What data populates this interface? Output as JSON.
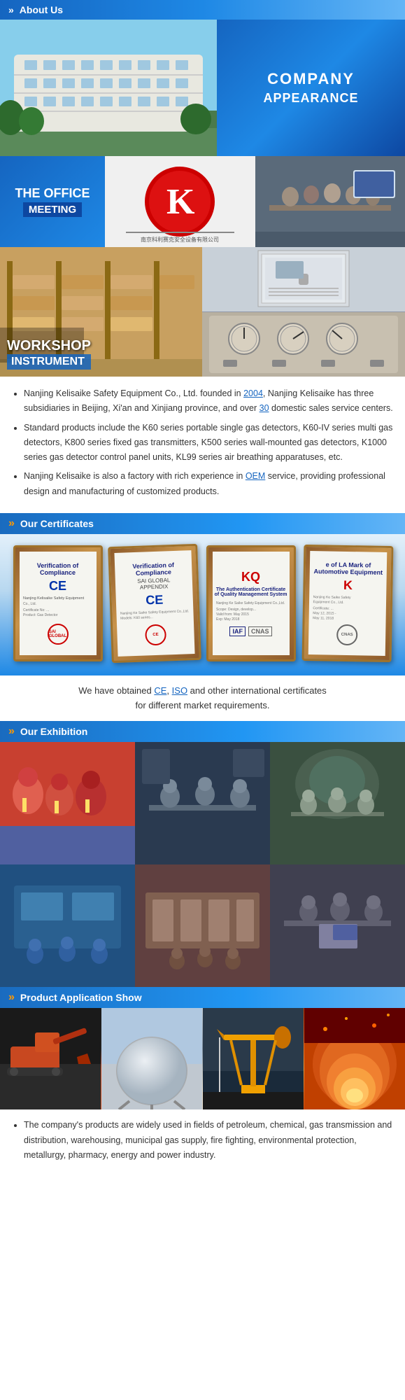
{
  "header": {
    "title": "About Us",
    "chevron": "»"
  },
  "sections": {
    "company": {
      "label_main": "COMPANY",
      "label_sub": "APPEARANCE",
      "office_main": "THE OFFICE",
      "office_sub": "MEETING",
      "workshop_main": "WORKSHOP",
      "workshop_sub": "INSTRUMENT"
    },
    "description": {
      "bullets": [
        "Nanjing Kelisaike Safety Equipment Co., Ltd. founded in 2004, Nanjing Kelisaike has three subsidiaries in Beijing, Xi'an and Xinjiang province, and over 30 domestic sales service centers.",
        "Standard products include the K60 series portable single gas detectors, K60-IV series multi gas detectors, K800 series fixed gas transmitters, K500 series wall-mounted gas detectors, K1000 series gas detector control panel units, KL99 series air breathing apparatuses, etc.",
        "Nanjing Kelisaike is also a factory with rich experience in OEM service, providing professional design and manufacturing of customized products."
      ],
      "highlights": [
        "2004",
        "30",
        "OEM"
      ]
    },
    "certificates": {
      "title": "Our Certificates",
      "chevron": "»",
      "caption_line1": "We have obtained CE, ISO and other international certificates",
      "caption_line2": "for different market requirements.",
      "highlights": [
        "CE",
        "ISO"
      ],
      "certs": [
        {
          "type": "verification",
          "logo": "CE",
          "title": "Verification of Compliance",
          "seal_text": "SAI"
        },
        {
          "type": "verification2",
          "logo": "CE",
          "title": "Verification of Compliance",
          "subtitle": "SAI GLOBAL APPENDIX"
        },
        {
          "type": "authentication",
          "logo": "KQ",
          "title": "The Authentication Certificate of Quality Management System",
          "seal_text": "IAF"
        },
        {
          "type": "la_mark",
          "logo": "K",
          "title": "e of LA Mark of Automotive Equipment",
          "seal_text": "CNAS"
        }
      ]
    },
    "exhibition": {
      "title": "Our Exhibition",
      "chevron": "»",
      "images": [
        {
          "id": "ex1",
          "class": "img-exhibition1"
        },
        {
          "id": "ex2",
          "class": "img-exhibition2"
        },
        {
          "id": "ex3",
          "class": "img-exhibition3"
        },
        {
          "id": "ex4",
          "class": "img-exhibition4"
        },
        {
          "id": "ex5",
          "class": "img-exhibition5"
        },
        {
          "id": "ex6",
          "class": "img-exhibition6"
        }
      ]
    },
    "product_application": {
      "title": "Product Application Show",
      "chevron": "»",
      "images": [
        {
          "id": "p1",
          "class": "img-product1"
        },
        {
          "id": "p2",
          "class": "img-product2"
        },
        {
          "id": "p3",
          "class": "img-product3"
        },
        {
          "id": "p4",
          "class": "img-product4"
        }
      ],
      "description": "The company's products are widely used in fields of petroleum, chemical, gas transmission and distribution, warehousing, municipal gas supply, fire fighting, environmental protection, metallurgy, pharmacy, energy and power industry."
    }
  }
}
